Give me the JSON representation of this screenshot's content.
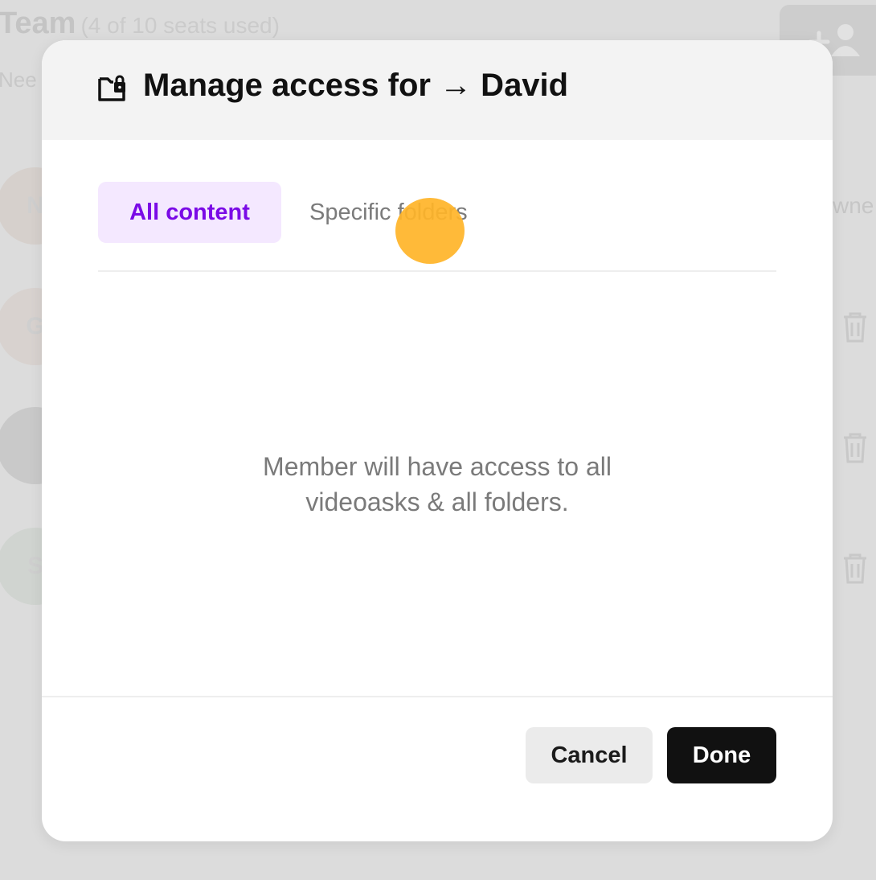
{
  "background": {
    "title": "Team",
    "seats": "(4 of 10 seats used)",
    "subtitle": "Nee",
    "owner_fragment": "wne",
    "avatars": [
      "N",
      "G",
      "",
      "S"
    ]
  },
  "modal": {
    "title": "Manage access for → David",
    "header_icon": "folder-lock-icon",
    "tabs": {
      "all_content": "All content",
      "specific_folders": "Specific folders",
      "active": "All content"
    },
    "message": "Member will have access to all videoasks & all folders.",
    "buttons": {
      "cancel": "Cancel",
      "done": "Done"
    }
  },
  "colors": {
    "accent": "#7a0ae6",
    "active_tab_bg": "#f4e8ff",
    "primary_button": "#111111",
    "click_indicator": "#ffb428"
  }
}
